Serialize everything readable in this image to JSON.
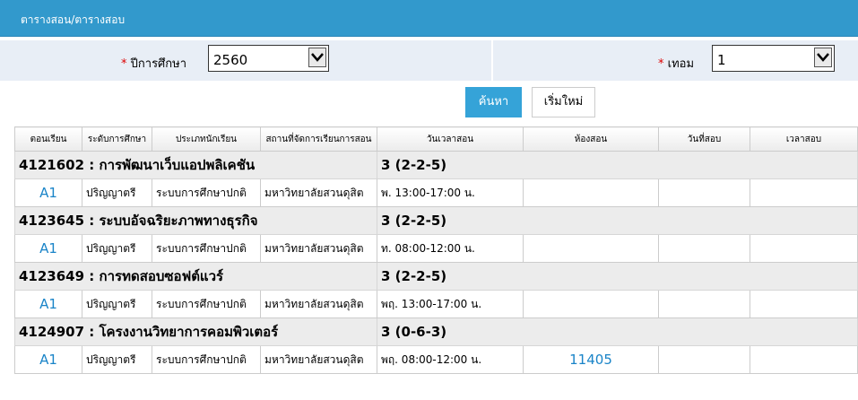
{
  "header": {
    "title": "ตารางสอน/ตารางสอบ"
  },
  "filters": {
    "year": {
      "required_mark": "*",
      "label": "ปีการศึกษา",
      "value": "2560"
    },
    "term": {
      "required_mark": "*",
      "label": "เทอม",
      "value": "1"
    }
  },
  "buttons": {
    "search": "ค้นหา",
    "reset": "เริ่มใหม่"
  },
  "table": {
    "columns": [
      "ตอนเรียน",
      "ระดับการศึกษา",
      "ประเภทนักเรียน",
      "สถานที่จัดการเรียนการสอน",
      "วันเวลาสอน",
      "ห้องสอน",
      "วันที่สอบ",
      "เวลาสอบ"
    ],
    "courses": [
      {
        "title": "4121602 : การพัฒนาเว็บแอปพลิเคชัน",
        "credits": "3 (2-2-5)",
        "section": {
          "sec": "A1",
          "level": "ปริญญาตรี",
          "type": "ระบบการศึกษาปกติ",
          "campus": "มหาวิทยาลัยสวนดุสิต",
          "time": "พ. 13:00-17:00 น.",
          "room": "",
          "exam_date": "",
          "exam_time": ""
        }
      },
      {
        "title": "4123645 : ระบบอัจฉริยะภาพทางธุรกิจ",
        "credits": "3 (2-2-5)",
        "section": {
          "sec": "A1",
          "level": "ปริญญาตรี",
          "type": "ระบบการศึกษาปกติ",
          "campus": "มหาวิทยาลัยสวนดุสิต",
          "time": "ท. 08:00-12:00 น.",
          "room": "",
          "exam_date": "",
          "exam_time": ""
        }
      },
      {
        "title": "4123649 : การทดสอบซอฟต์แวร์",
        "credits": "3 (2-2-5)",
        "section": {
          "sec": "A1",
          "level": "ปริญญาตรี",
          "type": "ระบบการศึกษาปกติ",
          "campus": "มหาวิทยาลัยสวนดุสิต",
          "time": "พฤ. 13:00-17:00 น.",
          "room": "",
          "exam_date": "",
          "exam_time": ""
        }
      },
      {
        "title": "4124907 : โครงงานวิทยาการคอมพิวเตอร์",
        "credits": "3 (0-6-3)",
        "section": {
          "sec": "A1",
          "level": "ปริญญาตรี",
          "type": "ระบบการศึกษาปกติ",
          "campus": "มหาวิทยาลัยสวนดุสิต",
          "time": "พฤ. 08:00-12:00 น.",
          "room": "11405",
          "exam_date": "",
          "exam_time": ""
        }
      }
    ]
  }
}
